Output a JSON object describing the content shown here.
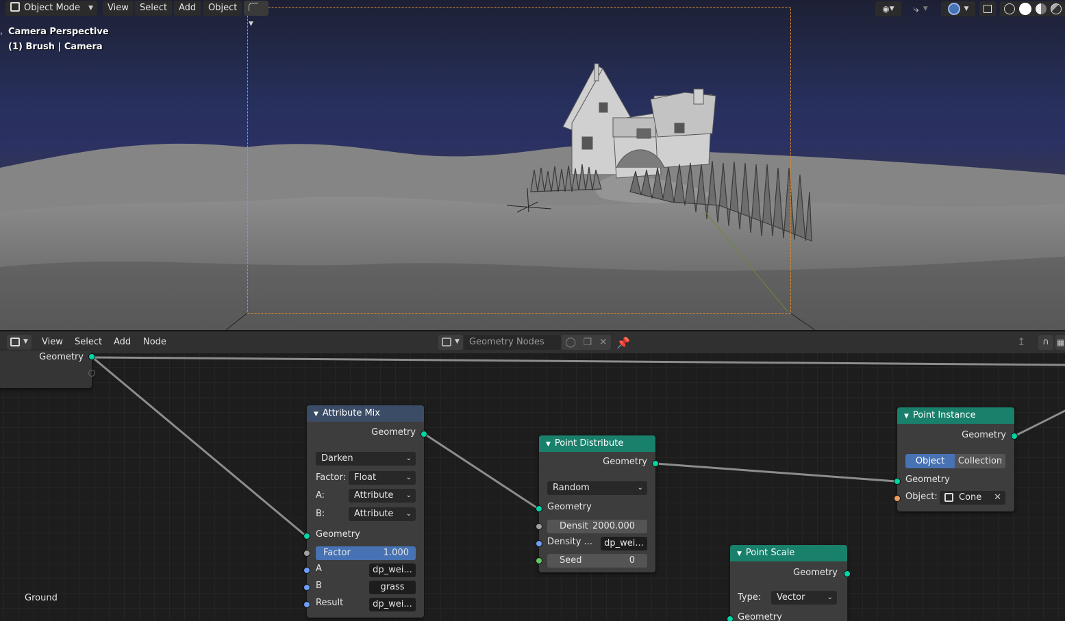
{
  "viewport": {
    "mode": "Object Mode",
    "menu": [
      "View",
      "Select",
      "Add",
      "Object"
    ],
    "info_line1": "Camera Perspective",
    "info_line2": "(1) Brush | Camera",
    "colors": {
      "sky_top": "#1d2034",
      "sky_mid": "#2b3163",
      "ground": "#7a7a7a",
      "camera_frame": "#e08a2c",
      "y_axis": "#6b8a3a"
    },
    "icons": [
      "object-mode-icon",
      "pivot-icon",
      "visibility-icon",
      "gizmo-icon",
      "overlay-icon",
      "xray-icon",
      "wireframe-shading-icon",
      "solid-shading-icon",
      "material-shading-icon",
      "rendered-shading-icon"
    ]
  },
  "node_editor": {
    "menu": [
      "View",
      "Select",
      "Add",
      "Node"
    ],
    "tree_name": "Geometry Nodes",
    "group_input": {
      "socket": "Geometry"
    },
    "ground_label": "Ground",
    "attribute_mix": {
      "title": "Attribute Mix",
      "out_geometry": "Geometry",
      "blend": "Darken",
      "factor_label": "Factor:",
      "factor_type": "Float",
      "a_label": "A:",
      "a_type": "Attribute",
      "b_label": "B:",
      "b_type": "Attribute",
      "in_geometry": "Geometry",
      "factor_name": "Factor",
      "factor_value": "1.000",
      "a_name": "A",
      "a_value": "dp_wei...",
      "b_name": "B",
      "b_value": "grass",
      "result_name": "Result",
      "result_value": "dp_wei..."
    },
    "point_distribute": {
      "title": "Point Distribute",
      "out_geometry": "Geometry",
      "method": "Random",
      "in_geometry": "Geometry",
      "density_label": "Densit",
      "density_value": "2000.000",
      "density_attr_label": "Density ...",
      "density_attr_value": "dp_wei...",
      "seed_label": "Seed",
      "seed_value": "0"
    },
    "point_instance": {
      "title": "Point Instance",
      "out_geometry": "Geometry",
      "seg_object": "Object",
      "seg_collection": "Collection",
      "in_geometry": "Geometry",
      "object_label": "Object:",
      "object_value": "Cone"
    },
    "point_scale": {
      "title": "Point Scale",
      "out_geometry": "Geometry",
      "type_label": "Type:",
      "type_value": "Vector",
      "in_geometry": "Geometry"
    },
    "colors": {
      "socket_geometry": "#00d6a3",
      "socket_float": "#a1a1a1",
      "socket_attribute": "#6e9dfa",
      "socket_int": "#63c763",
      "socket_object": "#ed9e5c",
      "header_attribute": "#3b4c66",
      "header_point": "#18806b",
      "factor_highlight": "#4772b3"
    }
  }
}
